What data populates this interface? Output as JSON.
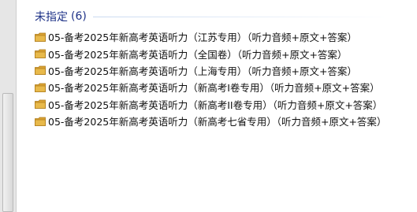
{
  "group": {
    "title": "未指定",
    "count": "(6)"
  },
  "items": [
    {
      "label": "05-备考2025年新高考英语听力（江苏专用）（听力音频+原文+答案）",
      "icon": "folder-icon"
    },
    {
      "label": "05-备考2025年新高考英语听力（全国卷）（听力音频+原文+答案）",
      "icon": "folder-icon"
    },
    {
      "label": "05-备考2025年新高考英语听力（上海专用）（听力音频+原文+答案）",
      "icon": "folder-icon"
    },
    {
      "label": "05-备考2025年新高考英语听力（新高考Ⅰ卷专用）（听力音频+原文+答案）",
      "icon": "folder-icon"
    },
    {
      "label": "05-备考2025年新高考英语听力（新高考II卷专用）（听力音频+原文+答案）",
      "icon": "folder-icon"
    },
    {
      "label": "05-备考2025年新高考英语听力（新高考七省专用）（听力音频+原文+答案）",
      "icon": "folder-icon"
    }
  ],
  "colors": {
    "group_title": "#1e3287",
    "folder_body": "#e8b94a",
    "folder_tab": "#d9a233"
  }
}
